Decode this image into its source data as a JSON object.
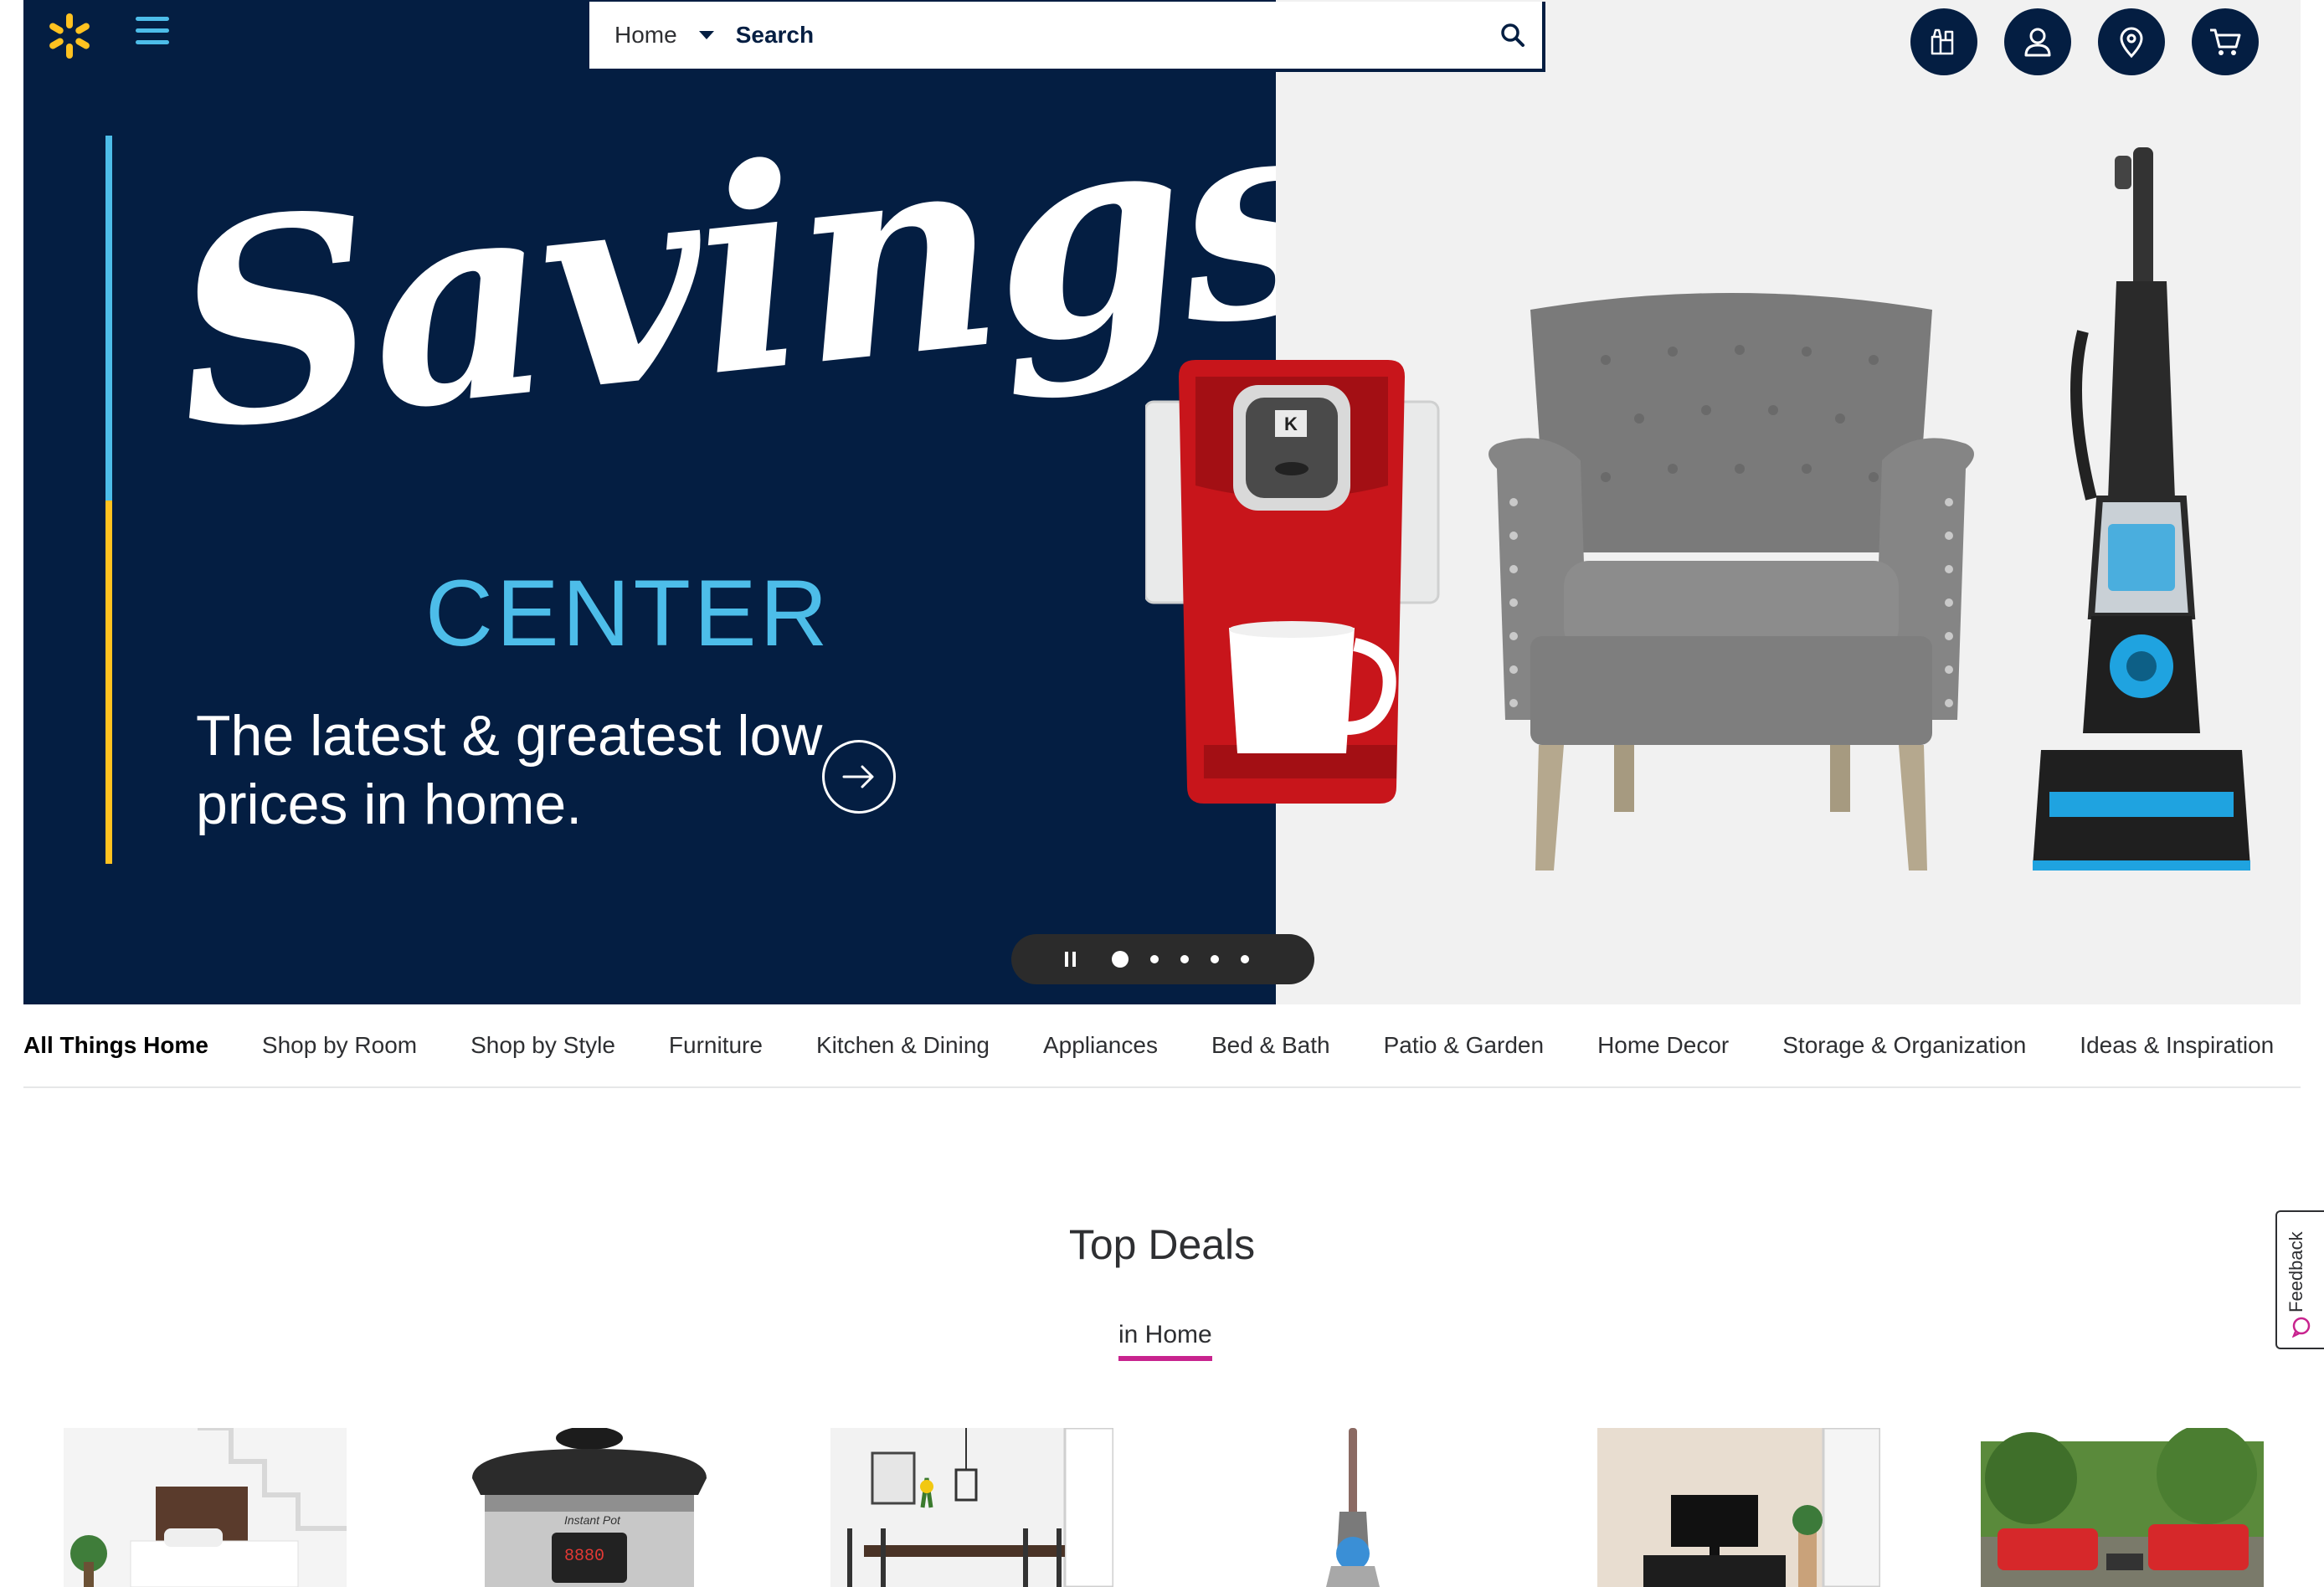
{
  "header": {
    "search": {
      "department": "Home",
      "placeholder": "Search"
    },
    "icons": [
      "reorder-icon",
      "account-icon",
      "store-location-icon",
      "cart-icon"
    ]
  },
  "hero": {
    "script_title": "Savings",
    "subtitle": "CENTER",
    "tagline": "The latest & greatest low prices in home.",
    "carousel": {
      "slides": 5,
      "active": 1
    }
  },
  "category_nav": {
    "items": [
      {
        "label": "All Things Home",
        "active": true
      },
      {
        "label": "Shop by Room"
      },
      {
        "label": "Shop by Style"
      },
      {
        "label": "Furniture"
      },
      {
        "label": "Kitchen & Dining"
      },
      {
        "label": "Appliances"
      },
      {
        "label": "Bed & Bath"
      },
      {
        "label": "Patio & Garden"
      },
      {
        "label": "Home Decor"
      },
      {
        "label": "Storage & Organization"
      },
      {
        "label": "Ideas & Inspiration"
      }
    ]
  },
  "deals": {
    "title": "Top Deals",
    "tab": "in Home",
    "tiles": [
      "bed",
      "pressure-cooker",
      "dining-set",
      "vacuum",
      "tv-stand",
      "patio-set"
    ]
  },
  "feedback": {
    "label": "Feedback"
  },
  "colors": {
    "navy": "#041e42",
    "blue": "#4dbde9",
    "yellow": "#ffc220",
    "pink": "#c8238e",
    "light_gray": "#f1f1f1"
  }
}
